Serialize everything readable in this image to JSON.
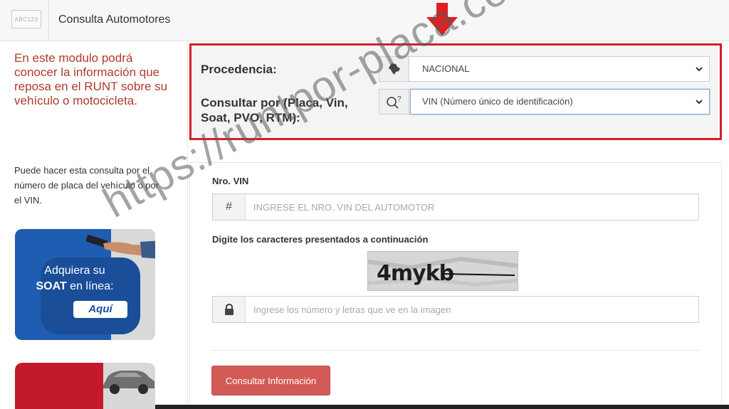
{
  "header": {
    "logo_text": "ABC123",
    "title": "Consulta Automotores"
  },
  "sidebar": {
    "intro_text": "En este modulo podrá conocer la información que reposa en el RUNT sobre su vehículo o motocicleta.",
    "help_text": "Puede hacer esta consulta por el número de placa del vehículo o por el VIN.",
    "ad_soat": {
      "line1": "Adquiera su",
      "line2_bold": "SOAT",
      "line2_rest": " en línea:",
      "button_label": "Aquí"
    }
  },
  "query_panel": {
    "procedencia_label": "Procedencia:",
    "procedencia_value": "NACIONAL",
    "procedencia_icon": "colombia-map-icon",
    "consultar_label": "Consultar por (Placa, Vin, Soat, PVO, RTM):",
    "consultar_value": "VIN (Número único de identificación)",
    "consultar_icon": "search-question-icon",
    "highlight_color": "#d4202a"
  },
  "form": {
    "vin_label": "Nro. VIN",
    "vin_addon": "#",
    "vin_placeholder": "INGRESE EL NRO. VIN DEL AUTOMOTOR",
    "vin_value": "",
    "captcha_label": "Digite los caracteres presentados a continuación",
    "captcha_text": "4mykb",
    "captcha_icon": "lock-icon",
    "captcha_placeholder": "Ingrese los número y letras que ve en la imagen",
    "captcha_value": "",
    "submit_label": "Consultar Información",
    "submit_color": "#d35a57"
  },
  "overlay": {
    "watermark": "https://runtpor-placa.co/",
    "arrow_icon": "arrow-down-icon",
    "arrow_color": "#e0201e"
  }
}
